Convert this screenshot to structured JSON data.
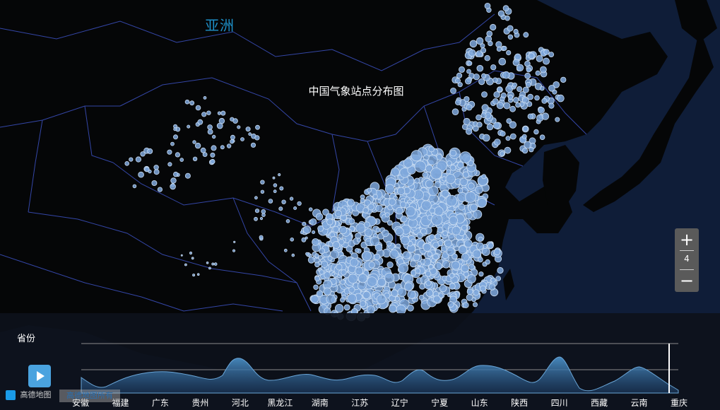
{
  "map": {
    "continent_label": "亚洲",
    "title": "中国气象站点分布图",
    "zoom_level": "4",
    "zoom_in_label": "+",
    "zoom_out_label": "−",
    "colors": {
      "background": "#0b1224",
      "land": "#050607",
      "ocean": "#0f1d38",
      "border": "#3446a6",
      "station": "#7fa8dc",
      "station_stroke": "#c9dcf2"
    }
  },
  "timeline": {
    "label": "省份",
    "play_icon": "play-icon",
    "current_index": 15,
    "provinces": [
      "安徽",
      "福建",
      "广东",
      "贵州",
      "河北",
      "黑龙江",
      "湖南",
      "江苏",
      "辽宁",
      "宁夏",
      "山东",
      "陕西",
      "四川",
      "西藏",
      "云南",
      "重庆"
    ]
  },
  "footer": {
    "brand": "高德地图",
    "attribution": "高德地图所有"
  }
}
